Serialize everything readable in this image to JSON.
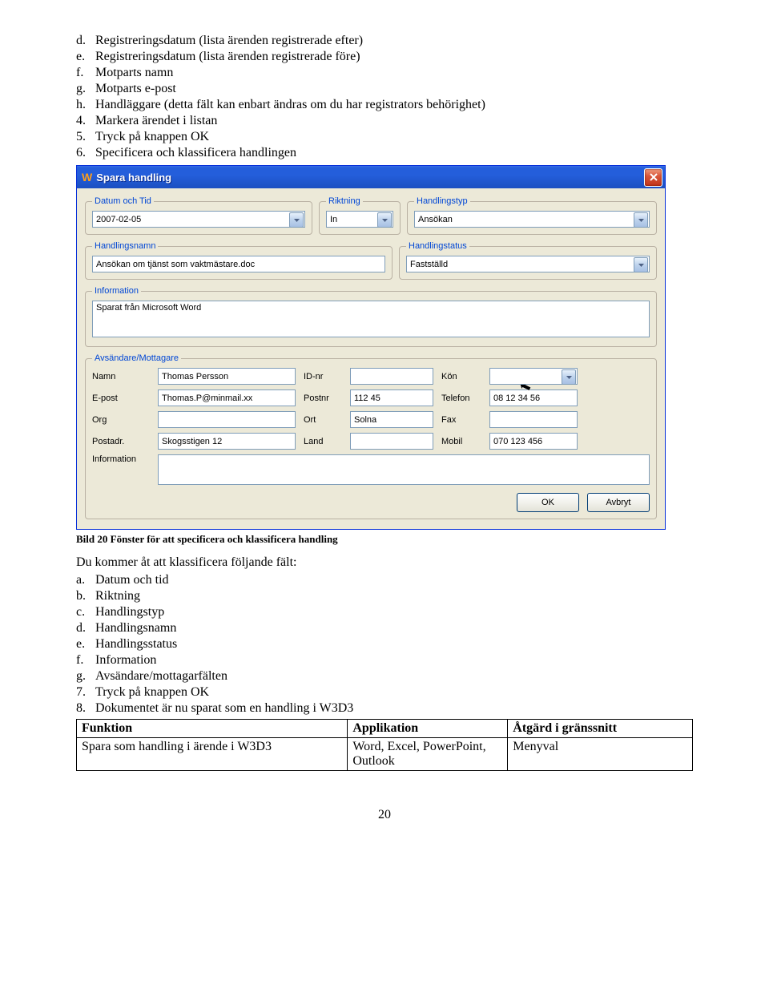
{
  "doc": {
    "list_top": [
      {
        "marker": "d.",
        "text": "Registreringsdatum (lista ärenden registrerade efter)",
        "indent": 2
      },
      {
        "marker": "e.",
        "text": "Registreringsdatum (lista ärenden registrerade före)",
        "indent": 2
      },
      {
        "marker": "f.",
        "text": "Motparts namn",
        "indent": 2
      },
      {
        "marker": "g.",
        "text": "Motparts e-post",
        "indent": 2
      },
      {
        "marker": "h.",
        "text": "Handläggare (detta fält kan enbart ändras om du har registrators behörighet)",
        "indent": 2
      },
      {
        "marker": "4.",
        "text": "Markera ärendet i listan",
        "indent": 1
      },
      {
        "marker": "5.",
        "text": "Tryck på knappen OK",
        "indent": 1
      },
      {
        "marker": "6.",
        "text": "Specificera och klassificera handlingen",
        "indent": 1
      }
    ],
    "caption": "Bild 20 Fönster för att specificera och klassificera handling",
    "para": "Du kommer åt att klassificera följande fält:",
    "list_bottom": [
      {
        "marker": "a.",
        "text": "Datum och tid",
        "indent": 2
      },
      {
        "marker": "b.",
        "text": "Riktning",
        "indent": 2
      },
      {
        "marker": "c.",
        "text": "Handlingstyp",
        "indent": 2
      },
      {
        "marker": "d.",
        "text": "Handlingsnamn",
        "indent": 2
      },
      {
        "marker": "e.",
        "text": "Handlingsstatus",
        "indent": 2
      },
      {
        "marker": "f.",
        "text": "Information",
        "indent": 2
      },
      {
        "marker": "g.",
        "text": "Avsändare/mottagarfälten",
        "indent": 2
      },
      {
        "marker": "7.",
        "text": "Tryck på knappen OK",
        "indent": 1
      },
      {
        "marker": "8.",
        "text": "Dokumentet är nu sparat som en handling i W3D3",
        "indent": 1
      }
    ],
    "table": {
      "headers": [
        "Funktion",
        "Applikation",
        "Åtgärd i gränssnitt"
      ],
      "rows": [
        [
          "Spara som handling i ärende i W3D3",
          "Word, Excel, PowerPoint, Outlook",
          "Menyval"
        ]
      ]
    },
    "page_number": "20"
  },
  "dialog": {
    "icon": "W",
    "title": "Spara handling",
    "legends": {
      "datum": "Datum och Tid",
      "riktning": "Riktning",
      "htyp": "Handlingstyp",
      "hnamn": "Handlingsnamn",
      "hstatus": "Handlingstatus",
      "info": "Information",
      "avs": "Avsändare/Mottagare"
    },
    "values": {
      "datum": "2007-02-05",
      "riktning": "In",
      "htyp": "Ansökan",
      "hnamn": "Ansökan om tjänst som vaktmästare.doc",
      "hstatus": "Fastställd",
      "info": "Sparat från Microsoft Word"
    },
    "contact": {
      "labels": {
        "namn": "Namn",
        "id": "ID-nr",
        "kon": "Kön",
        "epost": "E-post",
        "postnr": "Postnr",
        "tel": "Telefon",
        "org": "Org",
        "ort": "Ort",
        "fax": "Fax",
        "postadr": "Postadr.",
        "land": "Land",
        "mobil": "Mobil",
        "info": "Information"
      },
      "values": {
        "namn": "Thomas Persson",
        "id": "",
        "kon": "",
        "epost": "Thomas.P@minmail.xx",
        "postnr": "112 45",
        "tel": "08 12 34 56",
        "org": "",
        "ort": "Solna",
        "fax": "",
        "postadr": "Skogsstigen 12",
        "land": "",
        "mobil": "070 123 456",
        "info": ""
      }
    },
    "buttons": {
      "ok": "OK",
      "cancel": "Avbryt"
    }
  }
}
